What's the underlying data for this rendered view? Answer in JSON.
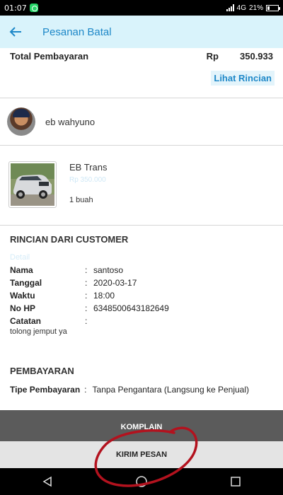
{
  "status_bar": {
    "time": "01:07",
    "network": "4G",
    "battery": "21%",
    "battery_level": 0.21
  },
  "app_bar": {
    "title": "Pesanan Batal",
    "back_icon": "arrow-left-icon"
  },
  "total": {
    "label": "Total Pembayaran",
    "currency": "Rp",
    "amount": "350.933",
    "details_link": "Lihat Rincian"
  },
  "seller": {
    "name": "eb wahyuno"
  },
  "product": {
    "name": "EB Trans",
    "price": "Rp 350.000",
    "quantity": "1 buah"
  },
  "customer": {
    "title": "RINCIAN DARI CUSTOMER",
    "detail_link": "Detail",
    "fields": [
      {
        "label": "Nama",
        "value": "santoso"
      },
      {
        "label": "Tanggal",
        "value": "2020-03-17"
      },
      {
        "label": "Waktu",
        "value": "18:00"
      },
      {
        "label": "No HP",
        "value": "6348500643182649"
      },
      {
        "label": "Catatan",
        "value": ""
      }
    ],
    "note": "tolong jemput ya"
  },
  "payment": {
    "title": "PEMBAYARAN",
    "type_label": "Tipe Pembayaran",
    "type_value": "Tanpa Pengantara (Langsung ke Penjual)"
  },
  "actions": {
    "complain": "KOMPLAIN",
    "send_message": "KIRIM PESAN"
  },
  "colors": {
    "accent": "#1e88c8",
    "app_bar_bg": "#d9f3fb",
    "annotation": "#b3121e"
  }
}
